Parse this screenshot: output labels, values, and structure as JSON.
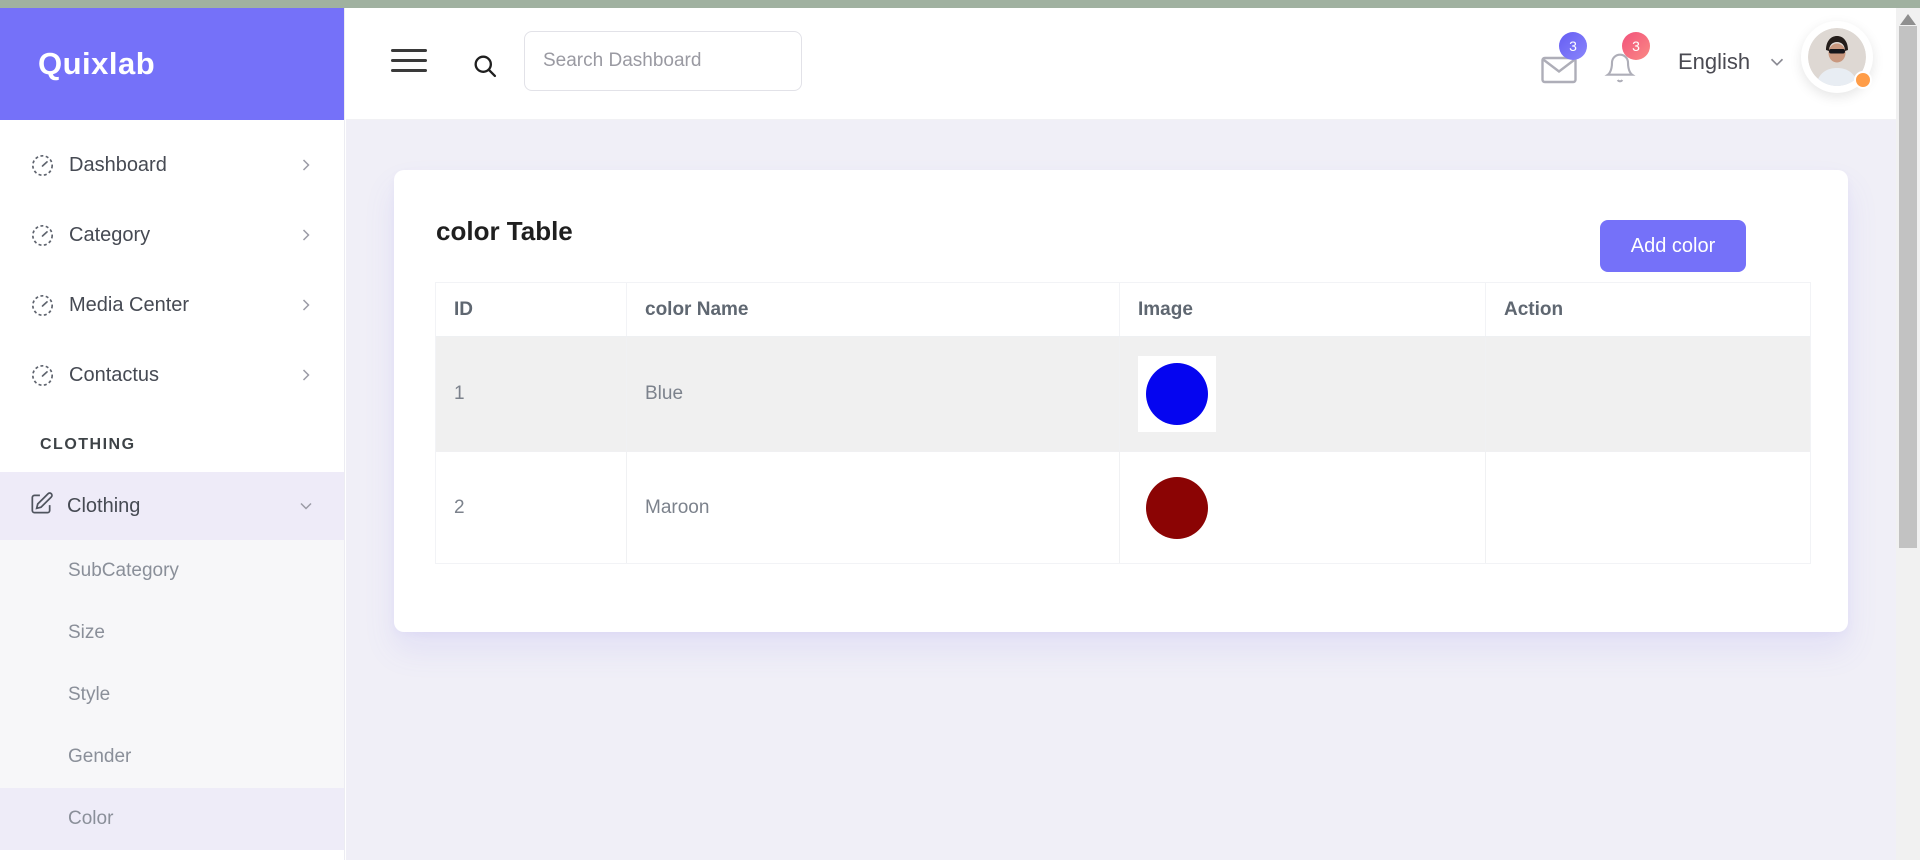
{
  "brand": {
    "name": "Quixlab"
  },
  "sidebar": {
    "items": [
      {
        "label": "Dashboard"
      },
      {
        "label": "Category"
      },
      {
        "label": "Media Center"
      },
      {
        "label": "Contactus"
      }
    ],
    "section_label": "CLOTHING",
    "clothing": {
      "label": "Clothing"
    },
    "submenu": [
      {
        "label": "SubCategory",
        "active": false
      },
      {
        "label": "Size",
        "active": false
      },
      {
        "label": "Style",
        "active": false
      },
      {
        "label": "Gender",
        "active": false
      },
      {
        "label": "Color",
        "active": true
      }
    ]
  },
  "header": {
    "search_placeholder": "Search Dashboard",
    "messages_badge": "3",
    "notifications_badge": "3",
    "language": "English"
  },
  "main": {
    "card_title": "color Table",
    "add_button_label": "Add color",
    "table": {
      "columns": [
        "ID",
        "color Name",
        "Image",
        "Action"
      ],
      "rows": [
        {
          "id": "1",
          "name": "Blue",
          "swatch": "#0505f0"
        },
        {
          "id": "2",
          "name": "Maroon",
          "swatch": "#8b0404"
        }
      ]
    }
  },
  "icons": {
    "menu": "hamburger",
    "search": "magnifier",
    "nav_item": "gauge",
    "clothing": "edit-pencil-square",
    "expand": "chevron-right",
    "collapse": "chevron-down",
    "messages": "envelope",
    "notifications": "bell",
    "scroll_up": "triangle-up"
  },
  "colors": {
    "accent": "#7571f9",
    "badge_pink": "#f4688f",
    "status_orange": "#ff9d48",
    "row_stripe": "#f0f0f0",
    "content_bg": "#f0eff7",
    "top_strip": "#a0b1a0"
  }
}
